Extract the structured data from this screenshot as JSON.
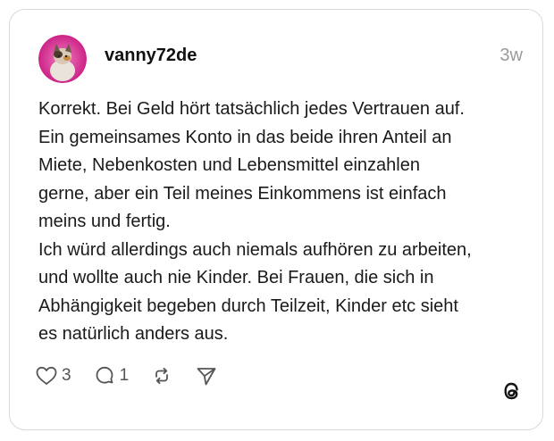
{
  "post": {
    "username": "vanny72de",
    "time": "3w",
    "lines": [
      "Korrekt. Bei Geld hört tatsächlich jedes Vertrauen auf.",
      "Ein gemeinsames Konto in das beide ihren Anteil an",
      "Miete, Nebenkosten und Lebensmittel einzahlen",
      "gerne, aber ein Teil meines Einkommens ist einfach",
      "meins und fertig.",
      "Ich würd allerdings auch niemals aufhören zu arbeiten,",
      "und wollte auch nie Kinder. Bei Frauen, die sich in",
      "Abhängigkeit begeben durch Teilzeit, Kinder etc sieht",
      "es natürlich anders aus."
    ]
  },
  "actions": {
    "like_count": "3",
    "reply_count": "1"
  },
  "icons": {
    "like": "heart-icon",
    "reply": "comment-icon",
    "repost": "repost-icon",
    "share": "send-icon",
    "brand": "threads-logo-icon"
  },
  "colors": {
    "avatar_ring": "#e0218a",
    "text": "#1a1a1a",
    "muted": "#9a9a9a",
    "border": "#d9d9d9"
  }
}
